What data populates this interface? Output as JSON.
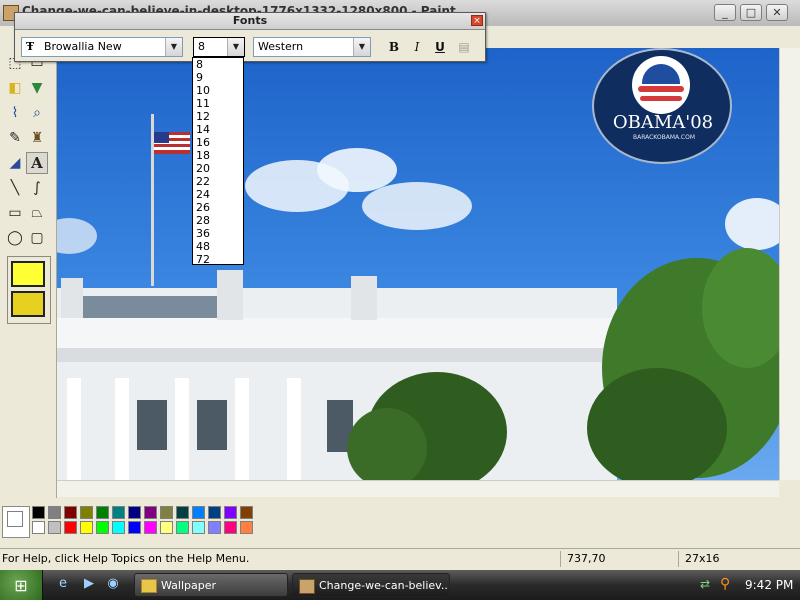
{
  "window": {
    "title": "Change-we-can-believe-in-desktop-1776x1332-1280x800 - Paint",
    "buttons": {
      "minimize": "_",
      "maximize": "□",
      "close": "✕"
    }
  },
  "fonts_toolbar": {
    "title": "Fonts",
    "close": "×",
    "font_name": "Browallia New",
    "font_icon": "Ŧ",
    "font_size": "8",
    "script": "Western",
    "bold": "B",
    "italic": "I",
    "underline": "U",
    "size_options": [
      "8",
      "9",
      "10",
      "11",
      "12",
      "14",
      "16",
      "18",
      "20",
      "22",
      "24",
      "26",
      "28",
      "36",
      "48",
      "72"
    ]
  },
  "tools": [
    {
      "icon": "free-form-select-icon",
      "glyph": "⬚"
    },
    {
      "icon": "select-icon",
      "glyph": "▭"
    },
    {
      "icon": "eraser-icon",
      "glyph": "◧"
    },
    {
      "icon": "fill-bucket-icon",
      "glyph": "▼"
    },
    {
      "icon": "color-picker-icon",
      "glyph": "⌇"
    },
    {
      "icon": "magnifier-icon",
      "glyph": "⌕"
    },
    {
      "icon": "pencil-icon",
      "glyph": "✎"
    },
    {
      "icon": "brush-icon",
      "glyph": "♜"
    },
    {
      "icon": "airbrush-icon",
      "glyph": "◢"
    },
    {
      "icon": "text-tool-icon",
      "glyph": "A"
    },
    {
      "icon": "line-tool-icon",
      "glyph": "╲"
    },
    {
      "icon": "curve-tool-icon",
      "glyph": "∫"
    },
    {
      "icon": "rectangle-tool-icon",
      "glyph": "▭"
    },
    {
      "icon": "polygon-tool-icon",
      "glyph": "⏢"
    },
    {
      "icon": "ellipse-tool-icon",
      "glyph": "◯"
    },
    {
      "icon": "rounded-rectangle-tool-icon",
      "glyph": "▢"
    }
  ],
  "canvas": {
    "badge_text": "OBAMA'08",
    "badge_small": "BARACKOBAMA.COM"
  },
  "palette": {
    "row1": [
      "#000000",
      "#808080",
      "#800000",
      "#808000",
      "#008000",
      "#008080",
      "#000080",
      "#800080",
      "#808040",
      "#004040",
      "#0080ff",
      "#004080",
      "#8000ff",
      "#804000"
    ],
    "row2": [
      "#ffffff",
      "#c0c0c0",
      "#ff0000",
      "#ffff00",
      "#00ff00",
      "#00ffff",
      "#0000ff",
      "#ff00ff",
      "#ffff80",
      "#00ff80",
      "#80ffff",
      "#8080ff",
      "#ff0080",
      "#ff8040"
    ]
  },
  "status": {
    "help": "For Help, click Help Topics on the Help Menu.",
    "coords": "737,70",
    "size": "27x16"
  },
  "taskbar": {
    "start_icon": "windows-flag-icon",
    "quick_launch": [
      "ie-icon",
      "media-player-icon",
      "messenger-icon"
    ],
    "tasks": [
      {
        "label": "Wallpaper"
      },
      {
        "label": "Change-we-can-believ..."
      }
    ],
    "tray_icons": [
      "network-icon",
      "search-tray-icon"
    ],
    "clock": "9:42 PM"
  }
}
